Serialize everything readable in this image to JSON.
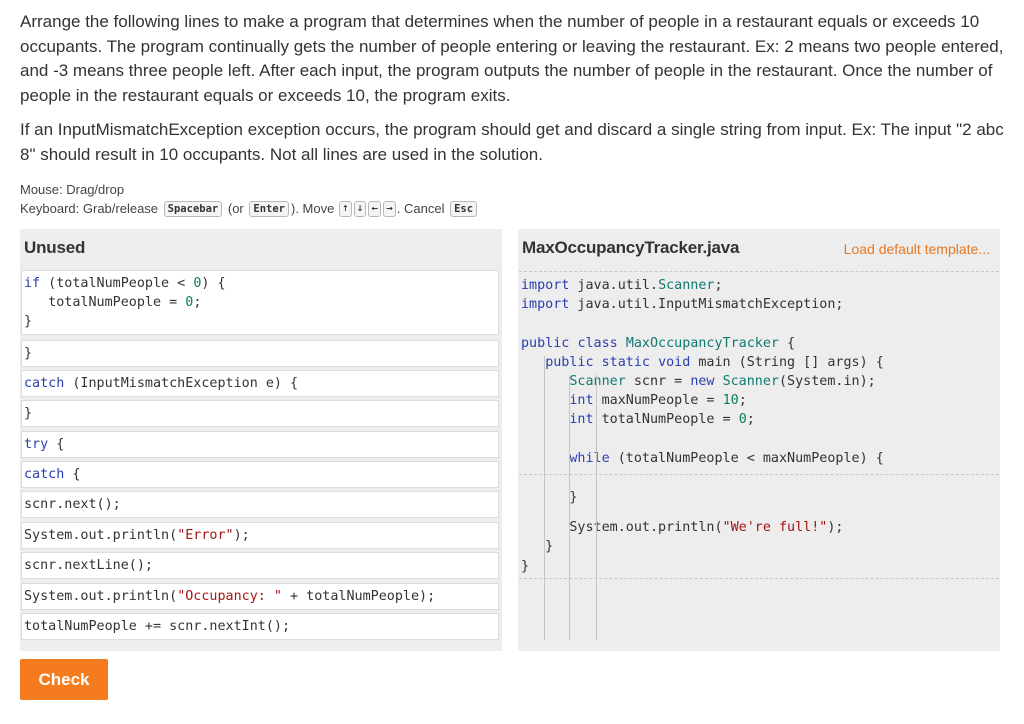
{
  "prompt": {
    "p1": "Arrange the following lines to make a program that determines when the number of people in a restaurant equals or exceeds 10 occupants. The program continually gets the number of people entering or leaving the restaurant. Ex: 2 means two people entered, and -3 means three people left. After each input, the program outputs the number of people in the restaurant. Once the number of people in the restaurant equals or exceeds 10, the program exits.",
    "p2": "If an InputMismatchException exception occurs, the program should get and discard a single string from input. Ex: The input \"2 abc 8\" should result in 10 occupants. Not all lines are used in the solution."
  },
  "help": {
    "mouse": "Mouse: Drag/drop",
    "keyboard_prefix": "Keyboard: Grab/release",
    "spacebar": "Spacebar",
    "or_open": "(or",
    "enter": "Enter",
    "move": "). Move",
    "up": "↑",
    "down": "↓",
    "left": "←",
    "right": "→",
    "cancel": ". Cancel",
    "esc": "Esc"
  },
  "unused": {
    "title": "Unused",
    "blocks": [
      [
        "if (totalNumPeople < 0) {",
        "   totalNumPeople = 0;",
        "}"
      ],
      [
        "}"
      ],
      [
        "catch (InputMismatchException e) {"
      ],
      [
        "}"
      ],
      [
        "try {"
      ],
      [
        "catch {"
      ],
      [
        "scnr.next();"
      ],
      [
        "System.out.println(\"Error\");"
      ],
      [
        "scnr.nextLine();"
      ],
      [
        "System.out.println(\"Occupancy: \" + totalNumPeople);"
      ],
      [
        "totalNumPeople += scnr.nextInt();"
      ]
    ]
  },
  "answer": {
    "filename": "MaxOccupancyTracker.java",
    "load_template": "Load default template...",
    "code": [
      "import java.util.Scanner;",
      "import java.util.InputMismatchException;",
      "",
      "public class MaxOccupancyTracker {",
      "   public static void main (String [] args) {",
      "      Scanner scnr = new Scanner(System.in);",
      "      int maxNumPeople = 10;",
      "      int totalNumPeople = 0;",
      "",
      "      while (totalNumPeople < maxNumPeople) {",
      "",
      "      }",
      "",
      "      System.out.println(\"We're full!\");",
      "   }",
      "}"
    ]
  },
  "check_label": "Check"
}
